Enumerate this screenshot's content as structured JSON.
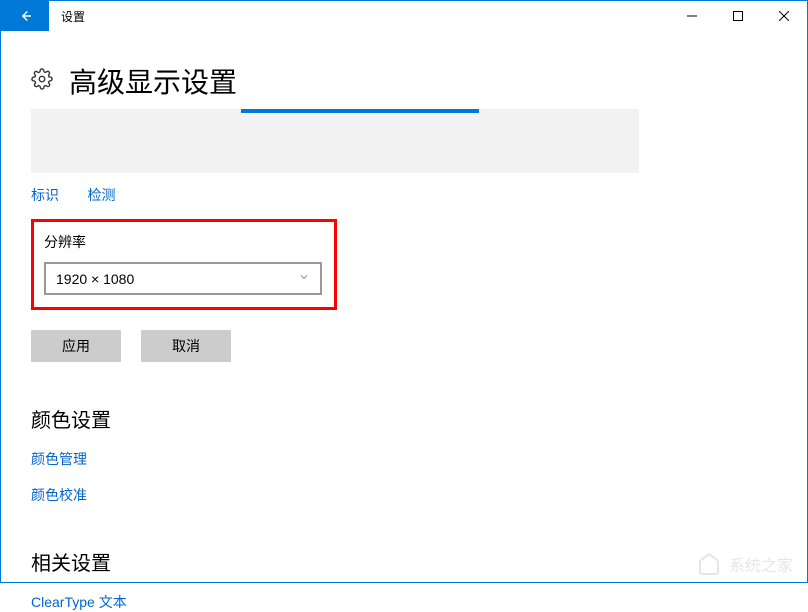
{
  "window": {
    "title": "设置"
  },
  "page": {
    "title": "高级显示设置"
  },
  "links": {
    "identify": "标识",
    "detect": "检测"
  },
  "resolution": {
    "label": "分辨率",
    "value": "1920 × 1080"
  },
  "buttons": {
    "apply": "应用",
    "cancel": "取消"
  },
  "color_section": {
    "title": "颜色设置",
    "color_management": "颜色管理",
    "color_calibration": "颜色校准"
  },
  "related_section": {
    "title": "相关设置",
    "cleartype": "ClearType 文本"
  },
  "watermark": "系统之家"
}
